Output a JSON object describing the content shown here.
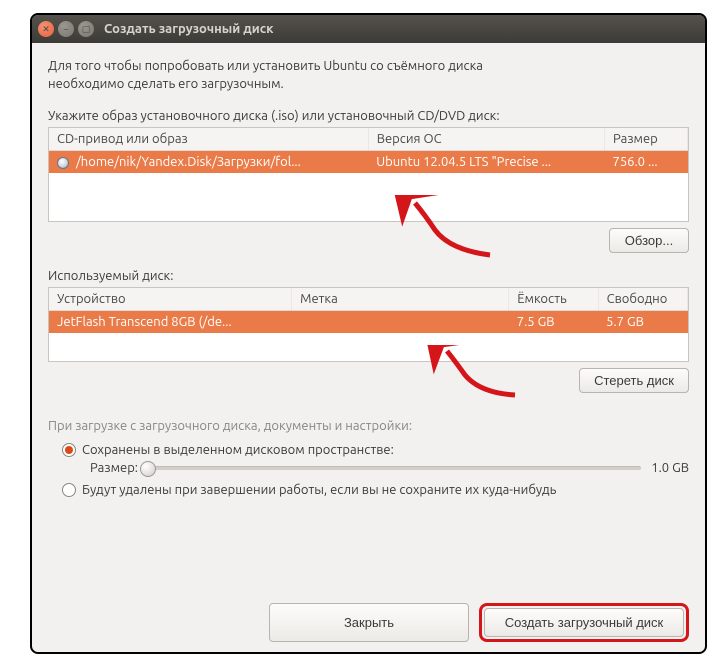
{
  "window": {
    "title": "Создать загрузочный диск"
  },
  "intro": {
    "line1": "Для того чтобы попробовать или установить Ubuntu со съёмного диска",
    "line2": "необходимо сделать его загрузочным."
  },
  "source": {
    "label": "Укажите образ установочного диска (.iso) или установочный CD/DVD диск:",
    "columns": {
      "drive": "CD-привод или образ",
      "os": "Версия ОС",
      "size": "Размер"
    },
    "row": {
      "drive": "/home/nik/Yandex.Disk/Загрузки/fol...",
      "os": "Ubuntu 12.04.5 LTS \"Precise ...",
      "size": "756.0 ..."
    },
    "browse_button": "Обзор..."
  },
  "target": {
    "label": "Используемый диск:",
    "columns": {
      "device": "Устройство",
      "label": "Метка",
      "capacity": "Ёмкость",
      "free": "Свободно"
    },
    "row": {
      "device": "JetFlash Transcend 8GB (/de...",
      "label": "",
      "capacity": "7.5 GB",
      "free": "5.7 GB"
    },
    "erase_button": "Стереть диск"
  },
  "persist": {
    "heading": "При загрузке с загрузочного диска, документы и настройки:",
    "opt_saved": "Сохранены в выделенном дисковом пространстве:",
    "size_label": "Размер:",
    "size_value": "1.0 GB",
    "opt_discard": "Будут удалены при завершении работы, если вы не сохраните их куда-нибудь"
  },
  "footer": {
    "close": "Закрыть",
    "make": "Создать загрузочный диск"
  }
}
